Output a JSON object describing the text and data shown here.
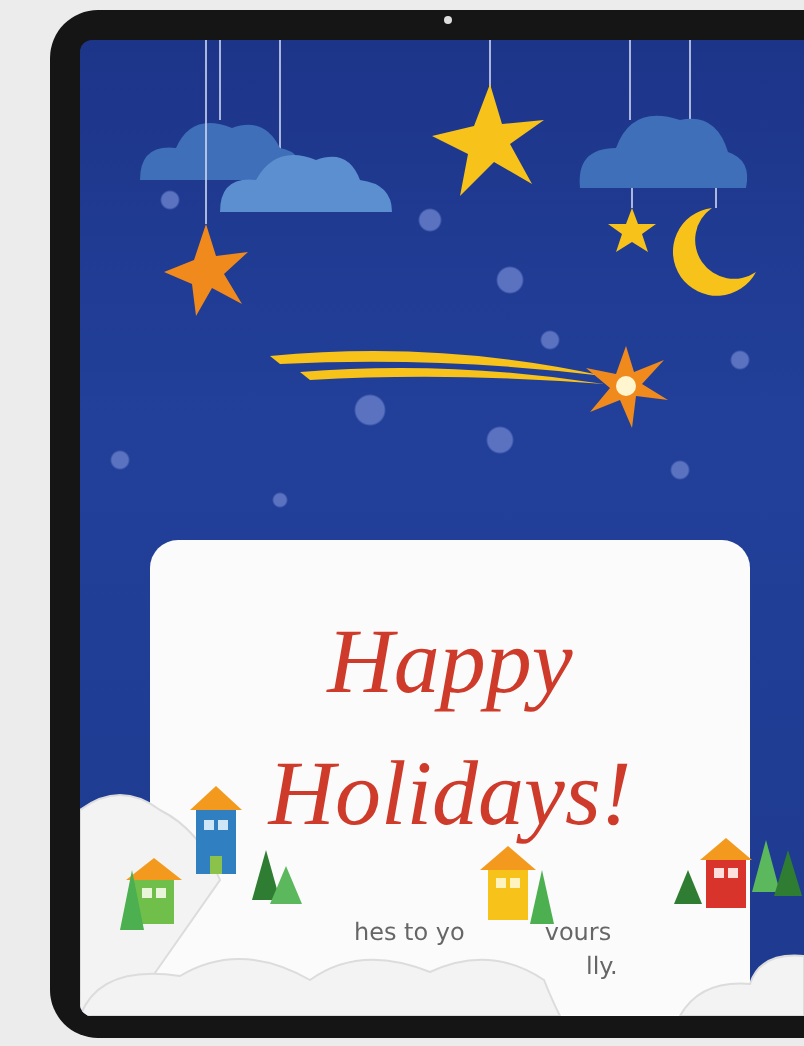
{
  "card": {
    "title_lines": [
      "Happy",
      "Holidays!"
    ],
    "message_lines": [
      {
        "fragments": [
          "hes to yo",
          "vours"
        ]
      },
      {
        "fragments": [
          "lly."
        ]
      }
    ]
  }
}
